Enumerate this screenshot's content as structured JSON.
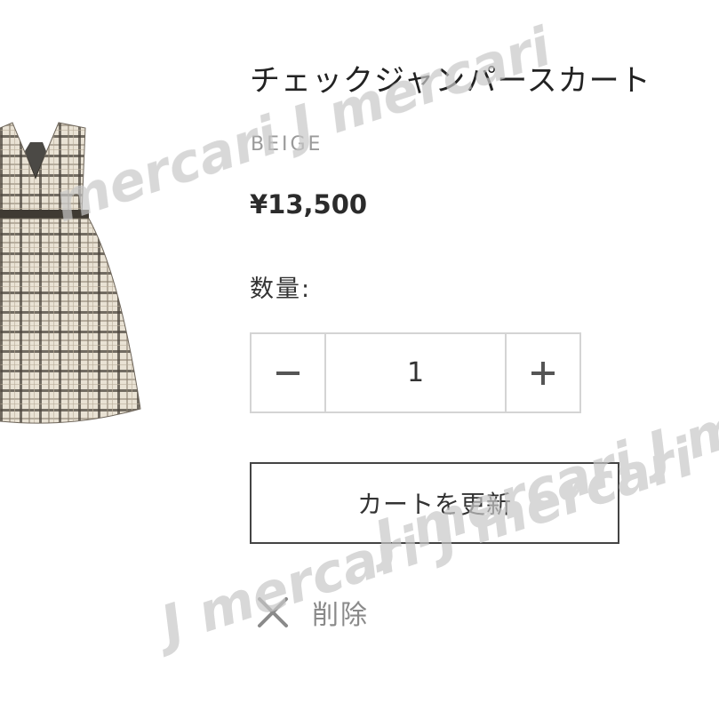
{
  "product": {
    "title": "チェックジャンパースカート",
    "variant": "BEIGE",
    "price": "¥13,500",
    "image_alt": "beige plaid jumper skirt"
  },
  "quantity": {
    "label": "数量:",
    "value": "1",
    "decrease_icon": "minus-icon",
    "increase_icon": "plus-icon"
  },
  "actions": {
    "update_cart_label": "カートを更新",
    "delete_label": "削除",
    "delete_icon": "close-icon"
  },
  "watermark": {
    "text_1": "mercari J mercari",
    "text_2": "J mercari J me",
    "text_3": "J mercari J mercari"
  },
  "colors": {
    "text": "#2b2b2b",
    "muted": "#9a9a9a",
    "border": "#d4d4d4",
    "button_border": "#444444",
    "watermark": "#c8c8c8"
  }
}
